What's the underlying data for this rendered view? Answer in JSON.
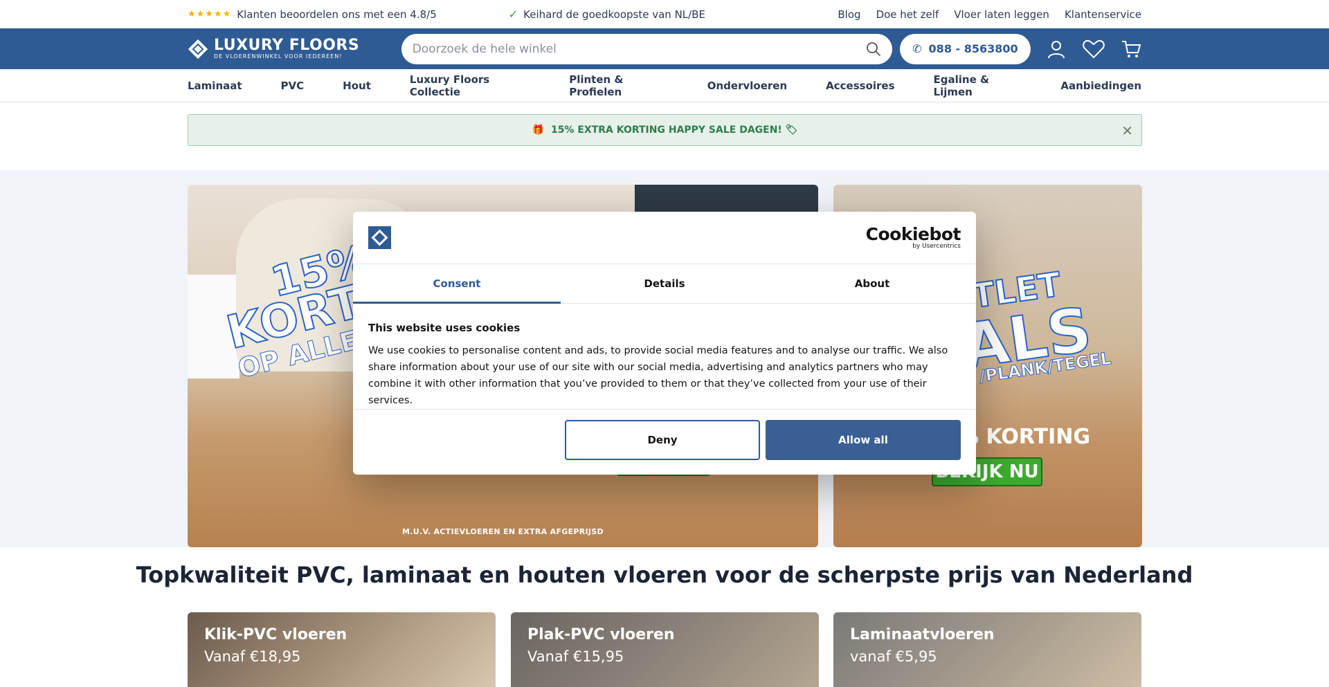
{
  "topbar": {
    "rating_text": "Klanten beoordelen ons met een 4.8/5",
    "usp_text": "Keihard de goedkoopste van NL/BE",
    "links": [
      "Blog",
      "Doe het zelf",
      "Vloer laten leggen",
      "Klantenservice"
    ]
  },
  "header": {
    "logo_name": "LUXURY FLOORS",
    "logo_tagline": "DE VLOERENWINKEL VOOR IEDEREEN!",
    "search_placeholder": "Doorzoek de hele winkel",
    "phone": "088 - 8563800"
  },
  "nav": {
    "items": [
      "Laminaat",
      "PVC",
      "Hout",
      "Luxury Floors Collectie",
      "Plinten & Profielen",
      "Ondervloeren",
      "Accessoires",
      "Egaline & Lijmen",
      "Aanbiedingen"
    ]
  },
  "promo": {
    "text": "15% EXTRA KORTING HAPPY SALE DAGEN! 🏷",
    "close": "✕"
  },
  "hero_main": {
    "line1": "15%",
    "line2": "KORTI",
    "line3": "OP ALLE VL",
    "fine_print": "M.U.V. ACTIEVLOEREN EN EXTRA AFGEPRIJSD"
  },
  "hero_side": {
    "line1": "TLET",
    "line2": "ALS",
    "line3": "/PLANK/TEGEL",
    "korting": "% KORTING",
    "button": "BEKIJK NU"
  },
  "headline": "Topkwaliteit PVC, laminaat en houten vloeren voor de scherpste prijs van Nederland",
  "cards": [
    {
      "title": "Klik-PVC vloeren",
      "price": "Vanaf €18,95"
    },
    {
      "title": "Plak-PVC vloeren",
      "price": "Vanaf €15,95"
    },
    {
      "title": "Laminaatvloeren",
      "price": "vanaf €5,95"
    }
  ],
  "cookie": {
    "brand": "Cookiebot",
    "brand_sub": "by Usercentrics",
    "tabs": [
      "Consent",
      "Details",
      "About"
    ],
    "title": "This website uses cookies",
    "text": "We use cookies to personalise content and ads, to provide social media features and to analyse our traffic. We also share information about your use of our site with our social media, advertising and analytics partners who may combine it with other information that you’ve provided to them or that they’ve collected from your use of their services.",
    "deny": "Deny",
    "allow": "Allow all"
  },
  "colors": {
    "brand_blue": "#2f5b94",
    "promo_green": "#2e7d4b",
    "star": "#f5b301"
  }
}
